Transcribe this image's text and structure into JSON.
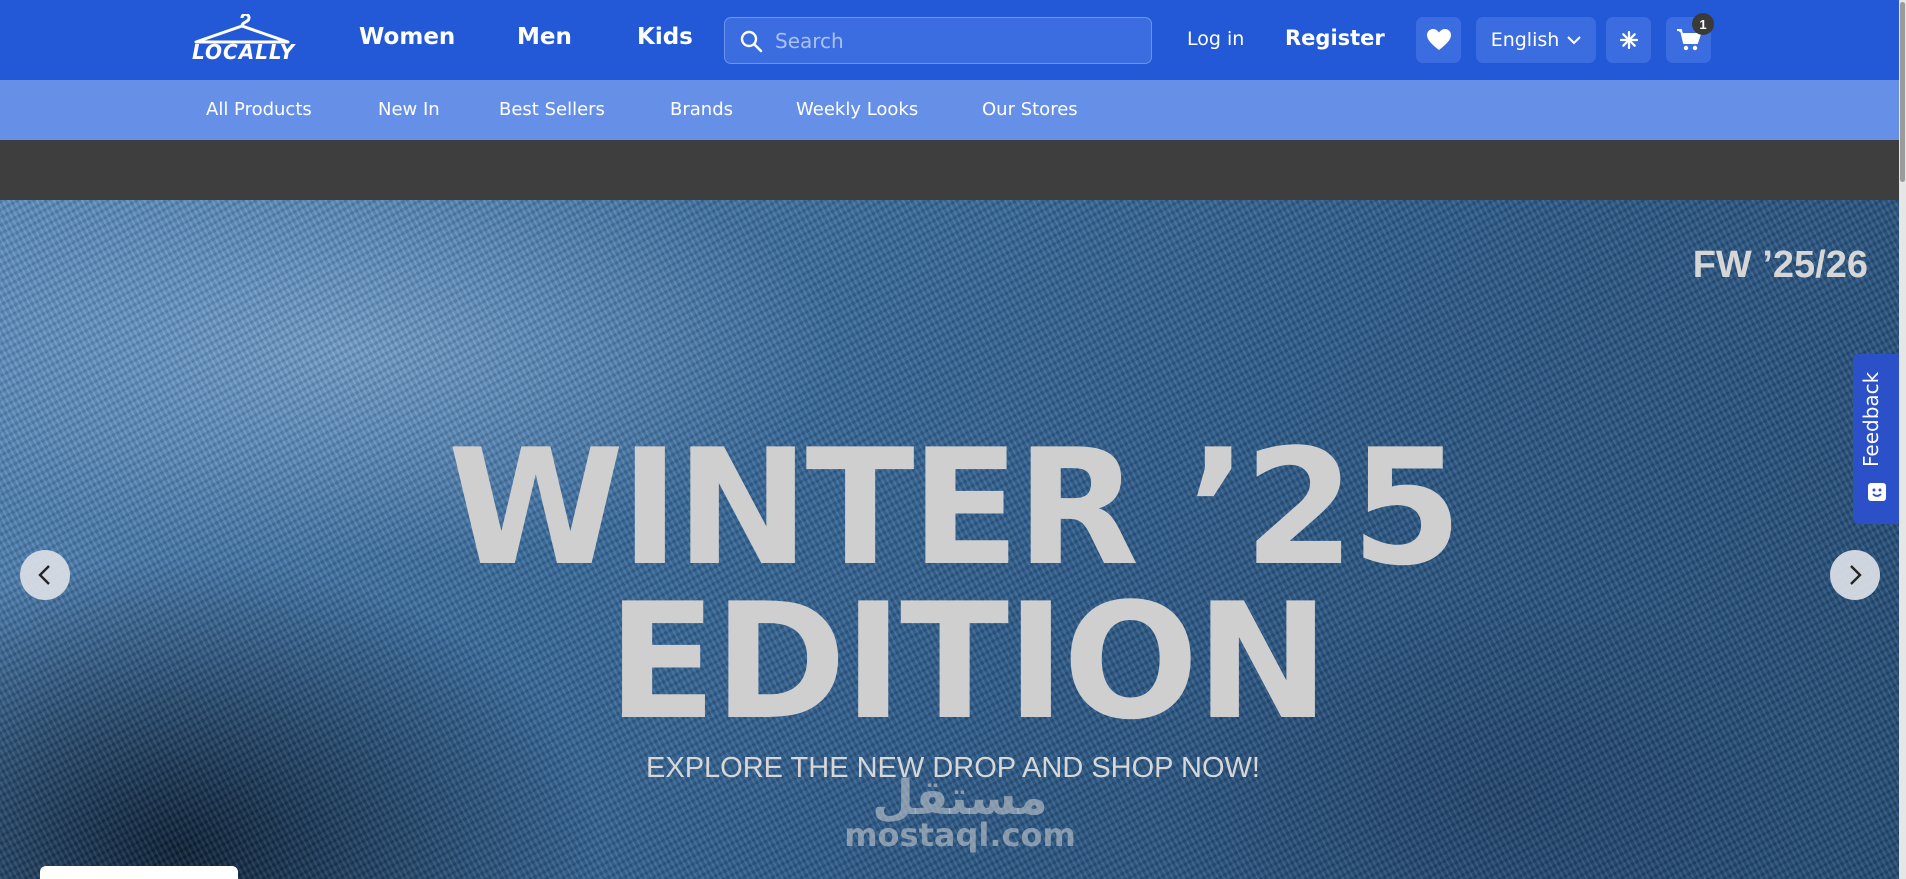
{
  "brand": {
    "logo_text": "LOCALLY"
  },
  "header": {
    "nav": {
      "women": "Women",
      "men": "Men",
      "kids": "Kids"
    },
    "search": {
      "placeholder": "Search",
      "value": ""
    },
    "login_label": "Log in",
    "register_label": "Register",
    "language": "English",
    "cart_count": "1",
    "icons": {
      "search": "search-icon",
      "wishlist": "heart-icon",
      "language": "chevron-down-icon",
      "theme": "snowflake-icon",
      "cart": "cart-icon"
    }
  },
  "subnav": {
    "items": [
      "All Products",
      "New In",
      "Best Sellers",
      "Brands",
      "Weekly Looks",
      "Our Stores"
    ]
  },
  "hero": {
    "season": "FW ’25/26",
    "title_line1": "WINTER ’25",
    "title_line2": "EDITION",
    "subtitle": "EXPLORE THE NEW DROP AND SHOP NOW!",
    "watermark_ar": "مستقل",
    "watermark_en": "mostaql.com"
  },
  "feedback": {
    "label": "Feedback"
  },
  "colors": {
    "header": "#2359d6",
    "subnav": "#6690e8",
    "strip": "#3e3e3e",
    "feedback": "#2c50c8"
  }
}
